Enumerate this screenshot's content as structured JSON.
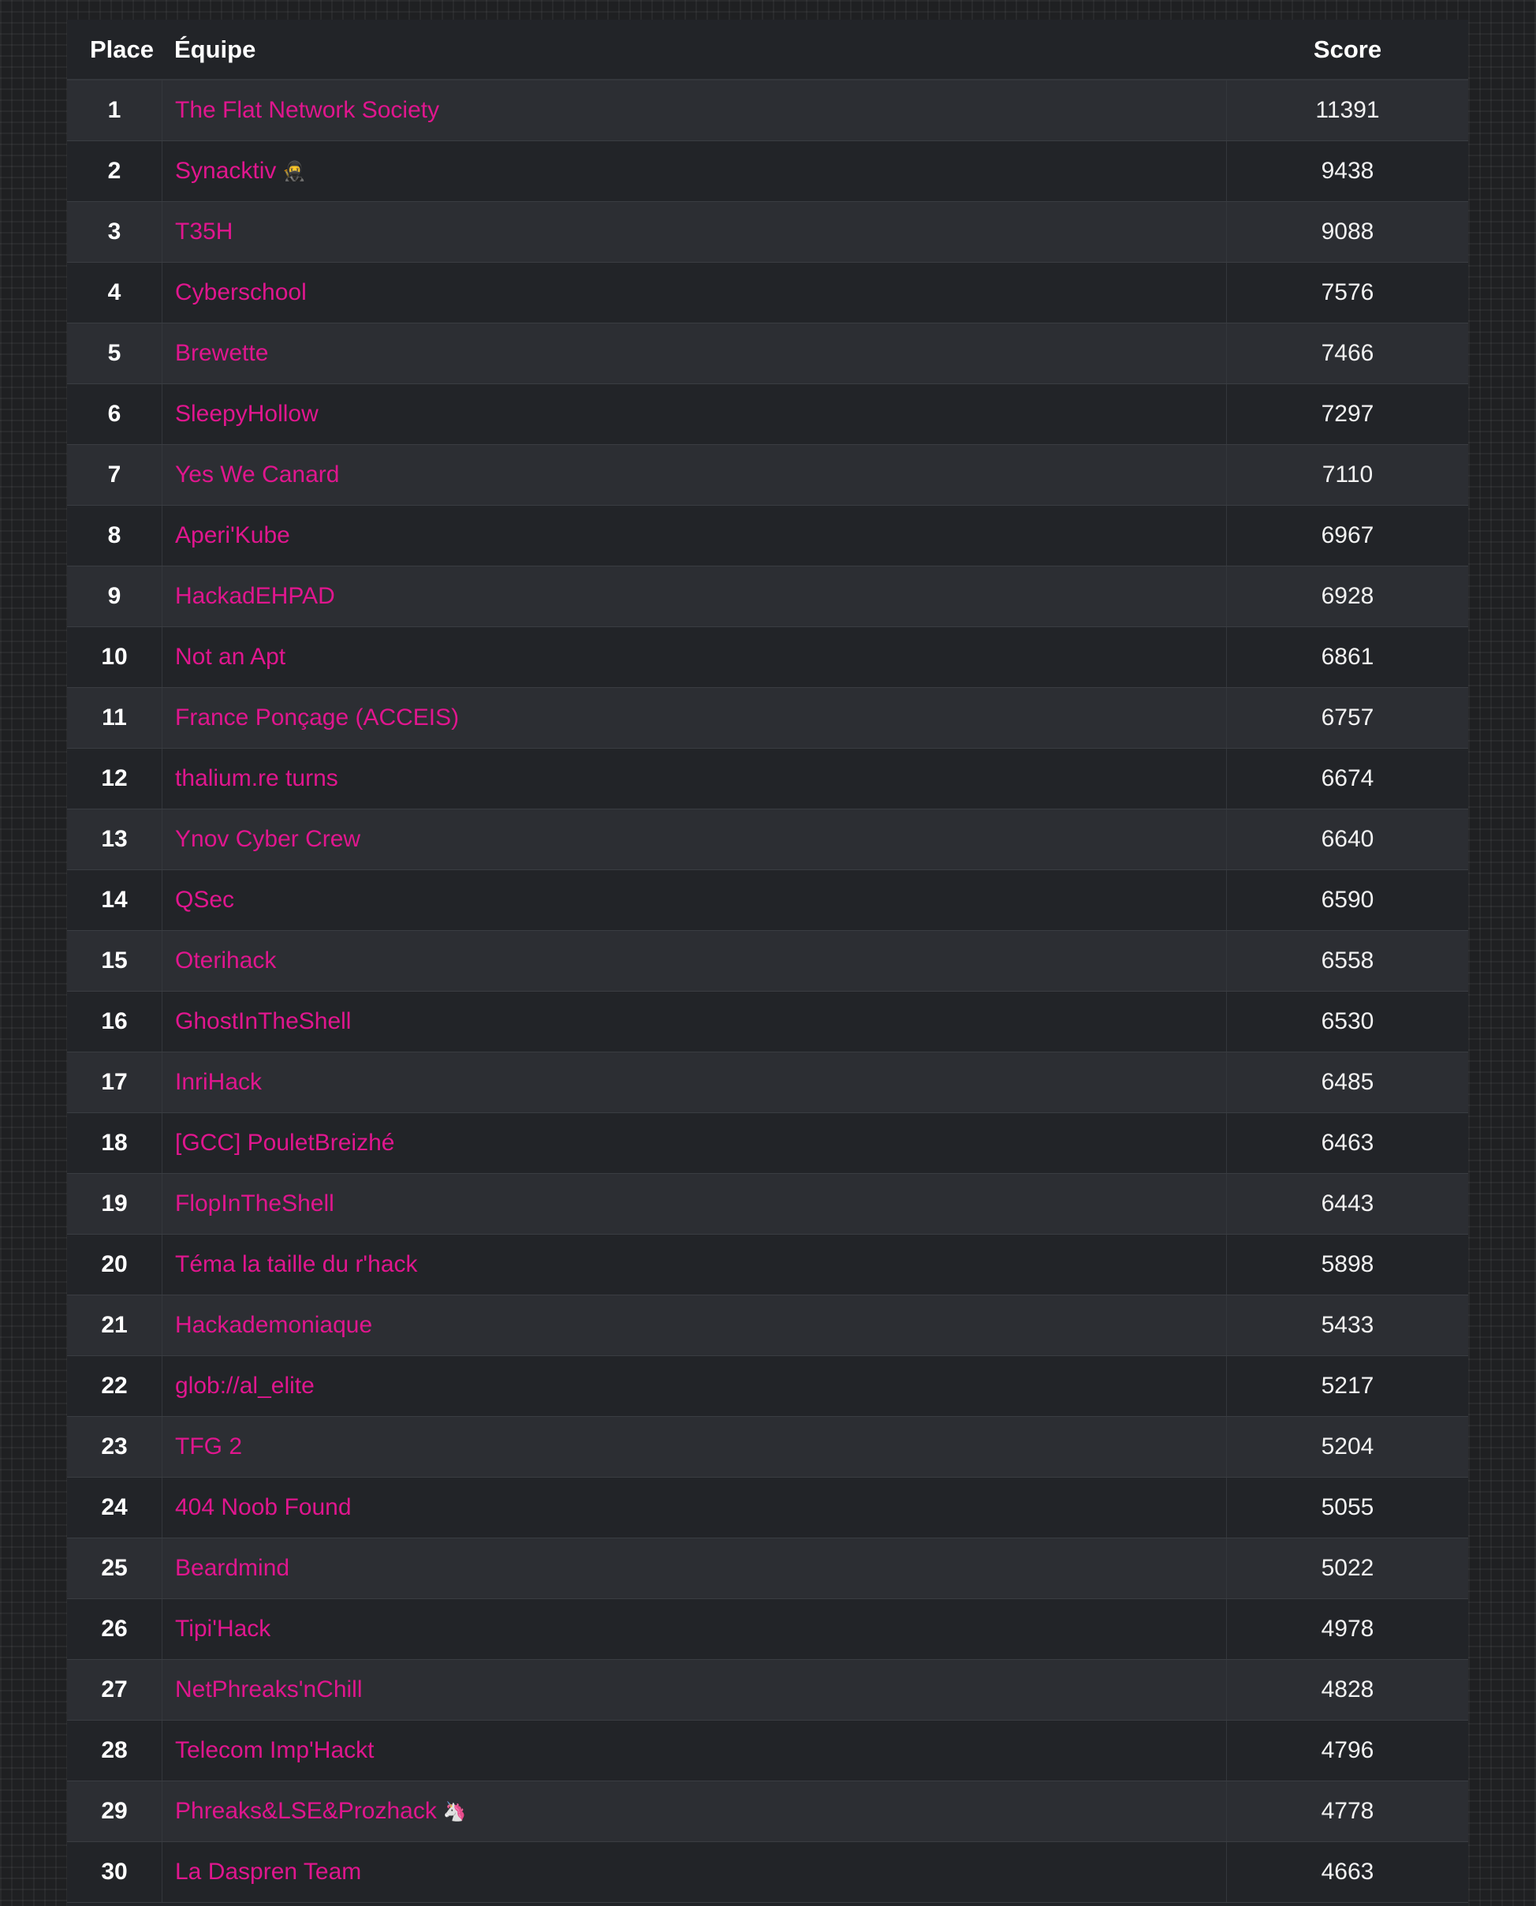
{
  "scoreboard": {
    "headers": {
      "place": "Place",
      "team": "Équipe",
      "score": "Score"
    },
    "colors": {
      "page_background": "#1f2022",
      "table_background": "#222428",
      "row_alt_background": "#2c2e33",
      "team_link": "#e0168e",
      "text": "#ffffff"
    },
    "rows": [
      {
        "place": "1",
        "team": "The Flat Network Society",
        "score": "11391",
        "emoji": ""
      },
      {
        "place": "2",
        "team": "Synacktiv",
        "score": "9438",
        "emoji": "🥷"
      },
      {
        "place": "3",
        "team": "T35H",
        "score": "9088",
        "emoji": ""
      },
      {
        "place": "4",
        "team": "Cyberschool",
        "score": "7576",
        "emoji": ""
      },
      {
        "place": "5",
        "team": "Brewette",
        "score": "7466",
        "emoji": ""
      },
      {
        "place": "6",
        "team": "SleepyHollow",
        "score": "7297",
        "emoji": ""
      },
      {
        "place": "7",
        "team": "Yes We Canard",
        "score": "7110",
        "emoji": ""
      },
      {
        "place": "8",
        "team": "Aperi'Kube",
        "score": "6967",
        "emoji": ""
      },
      {
        "place": "9",
        "team": "HackadEHPAD",
        "score": "6928",
        "emoji": ""
      },
      {
        "place": "10",
        "team": "Not an Apt",
        "score": "6861",
        "emoji": ""
      },
      {
        "place": "11",
        "team": "France Ponçage (ACCEIS)",
        "score": "6757",
        "emoji": ""
      },
      {
        "place": "12",
        "team": "thalium.re turns",
        "score": "6674",
        "emoji": ""
      },
      {
        "place": "13",
        "team": "Ynov Cyber Crew",
        "score": "6640",
        "emoji": ""
      },
      {
        "place": "14",
        "team": "QSec",
        "score": "6590",
        "emoji": ""
      },
      {
        "place": "15",
        "team": "Oterihack",
        "score": "6558",
        "emoji": ""
      },
      {
        "place": "16",
        "team": "GhostInTheShell",
        "score": "6530",
        "emoji": ""
      },
      {
        "place": "17",
        "team": "InriHack",
        "score": "6485",
        "emoji": ""
      },
      {
        "place": "18",
        "team": "[GCC] PouletBreizhé",
        "score": "6463",
        "emoji": ""
      },
      {
        "place": "19",
        "team": "FlopInTheShell",
        "score": "6443",
        "emoji": ""
      },
      {
        "place": "20",
        "team": "Téma la taille du r'hack",
        "score": "5898",
        "emoji": ""
      },
      {
        "place": "21",
        "team": "Hackademoniaque",
        "score": "5433",
        "emoji": ""
      },
      {
        "place": "22",
        "team": "glob://al_elite",
        "score": "5217",
        "emoji": ""
      },
      {
        "place": "23",
        "team": "TFG 2",
        "score": "5204",
        "emoji": ""
      },
      {
        "place": "24",
        "team": "404 Noob Found",
        "score": "5055",
        "emoji": ""
      },
      {
        "place": "25",
        "team": "Beardmind",
        "score": "5022",
        "emoji": ""
      },
      {
        "place": "26",
        "team": "Tipi'Hack",
        "score": "4978",
        "emoji": ""
      },
      {
        "place": "27",
        "team": "NetPhreaks'nChill",
        "score": "4828",
        "emoji": ""
      },
      {
        "place": "28",
        "team": "Telecom Imp'Hackt",
        "score": "4796",
        "emoji": ""
      },
      {
        "place": "29",
        "team": "Phreaks&LSE&Prozhack",
        "score": "4778",
        "emoji": "🦄"
      },
      {
        "place": "30",
        "team": "La Daspren Team",
        "score": "4663",
        "emoji": ""
      }
    ]
  }
}
